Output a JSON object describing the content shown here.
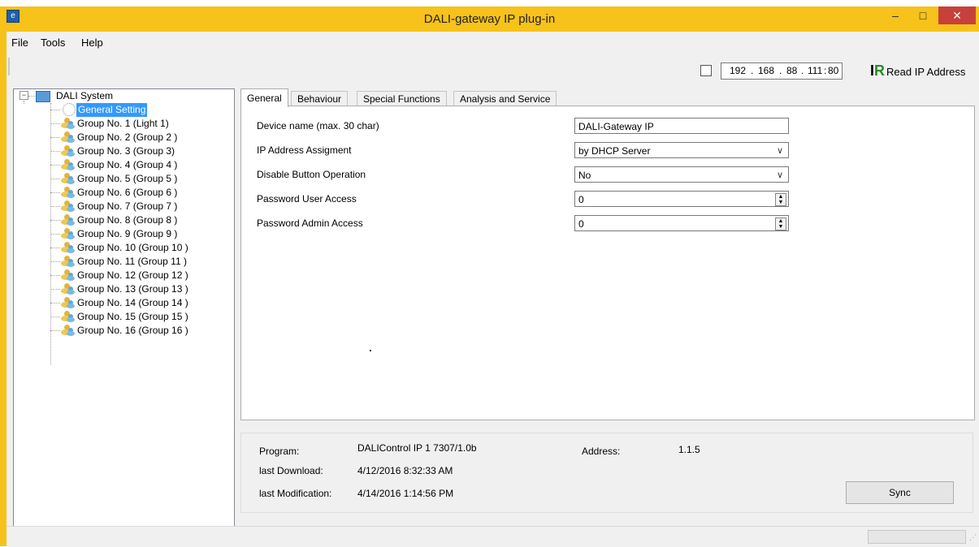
{
  "window": {
    "title": "DALI-gateway IP plug-in",
    "app_icon": "e",
    "minimize": "–",
    "maximize": "□",
    "close": "✕"
  },
  "menu": [
    "File",
    "Tools",
    "Help"
  ],
  "toolbar": {
    "ip_octets": [
      "192",
      "168",
      "88",
      "111"
    ],
    "ip_port": "80",
    "read_ip_label": "Read IP Address"
  },
  "tree": {
    "root": "DALI System",
    "selected": "General Setting",
    "groups": [
      "Group No. 1 (Light 1)",
      "Group No. 2 (Group  2 )",
      "Group No. 3 (Group  3)",
      "Group No. 4 (Group  4 )",
      "Group No. 5 (Group  5 )",
      "Group No. 6 (Group  6 )",
      "Group No. 7 (Group  7 )",
      "Group No. 8 (Group  8 )",
      "Group No. 9 (Group  9 )",
      "Group No. 10 (Group 10 )",
      "Group No. 11 (Group 11 )",
      "Group No. 12 (Group 12 )",
      "Group No. 13 (Group 13 )",
      "Group No. 14 (Group 14 )",
      "Group No. 15 (Group 15 )",
      "Group No. 16 (Group 16 )"
    ]
  },
  "tabs": [
    "General",
    "Behaviour",
    "Special Functions",
    "Analysis and Service"
  ],
  "general": {
    "device_name_label": "Device name (max. 30 char)",
    "device_name_value": "DALI-Gateway IP",
    "ip_assign_label": "IP Address Assigment",
    "ip_assign_value": "by DHCP Server",
    "disable_btn_label": "Disable Button Operation",
    "disable_btn_value": "No",
    "pw_user_label": "Password User Access",
    "pw_user_value": "0",
    "pw_admin_label": "Password Admin Access",
    "pw_admin_value": "0"
  },
  "info": {
    "program_label": "Program:",
    "program_value": "DALIControl IP 1 7307/1.0b",
    "address_label": "Address:",
    "address_value": "1.1.5",
    "last_download_label": "last Download:",
    "last_download_value": "4/12/2016 8:32:33 AM",
    "last_mod_label": "last Modification:",
    "last_mod_value": "4/14/2016 1:14:56 PM",
    "sync_label": "Sync"
  }
}
